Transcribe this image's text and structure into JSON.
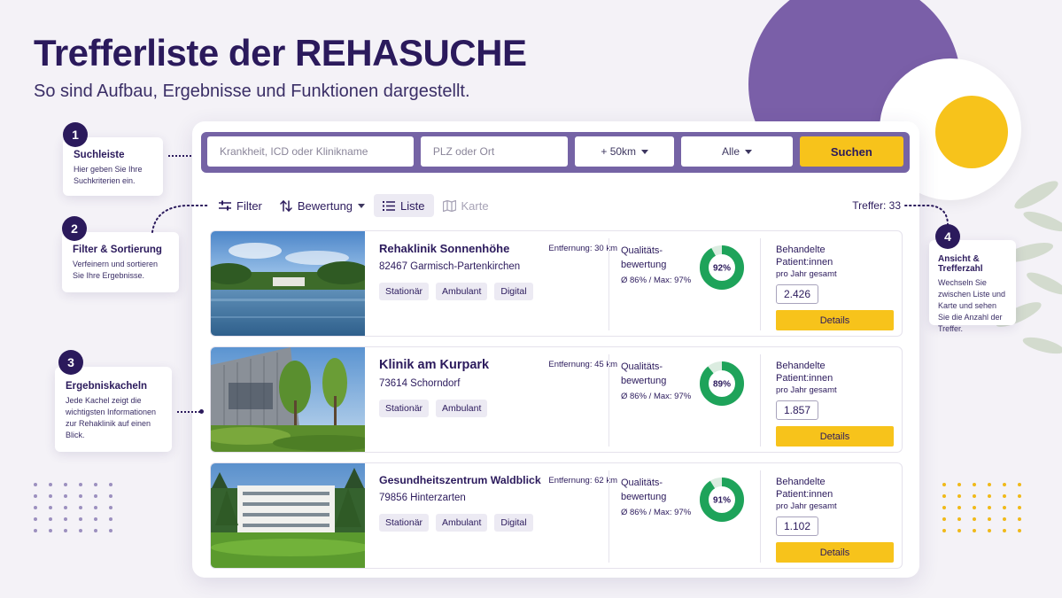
{
  "header": {
    "title": "Trefferliste der REHASUCHE",
    "subtitle": "So sind Aufbau, Ergebnisse und Funktionen dargestellt."
  },
  "search": {
    "query_placeholder": "Krankheit, ICD oder Klinikname",
    "location_placeholder": "PLZ oder Ort",
    "radius": "+ 50km",
    "type": "Alle",
    "submit_label": "Suchen"
  },
  "toolbar": {
    "filter_label": "Filter",
    "sort_label": "Bewertung",
    "list_label": "Liste",
    "map_label": "Karte",
    "result_count": "Treffer: 33"
  },
  "results": [
    {
      "name": "Rehaklinik Sonnenhöhe",
      "city": "82467 Garmisch-Partenkirchen",
      "distance": "Entfernung: 30 km",
      "tags": [
        "Stationär",
        "Ambulant",
        "Digital"
      ],
      "quality_label": "Qualitäts-bewertung",
      "quality_avg": "Ø 86% / Max: 97%",
      "quality_score": 92,
      "quality_score_label": "92%",
      "patients_label": "Behandelte Patient:innen",
      "patients_sub": "pro Jahr gesamt",
      "patients_value": "2.426",
      "details_label": "Details"
    },
    {
      "name": "Klinik am Kurpark",
      "city": "73614 Schorndorf",
      "distance": "Entfernung: 45 km",
      "tags": [
        "Stationär",
        "Ambulant"
      ],
      "quality_label": "Qualitäts-bewertung",
      "quality_avg": "Ø 86% / Max: 97%",
      "quality_score": 89,
      "quality_score_label": "89%",
      "patients_label": "Behandelte Patient:innen",
      "patients_sub": "pro Jahr gesamt",
      "patients_value": "1.857",
      "details_label": "Details"
    },
    {
      "name": "Gesundheitszentrum Waldblick",
      "city": "79856 Hinterzarten",
      "distance": "Entfernung: 62 km",
      "tags": [
        "Stationär",
        "Ambulant",
        "Digital"
      ],
      "quality_label": "Qualitäts-bewertung",
      "quality_avg": "Ø 86% / Max: 97%",
      "quality_score": 91,
      "quality_score_label": "91%",
      "patients_label": "Behandelte Patient:innen",
      "patients_sub": "pro Jahr gesamt",
      "patients_value": "1.102",
      "details_label": "Details"
    }
  ],
  "callouts": [
    {
      "number": "1",
      "title": "Suchleiste",
      "text": "Hier geben Sie Ihre Suchkriterien ein."
    },
    {
      "number": "2",
      "title": "Filter & Sortierung",
      "text": "Verfeinern und sortieren Sie Ihre Ergebnisse."
    },
    {
      "number": "3",
      "title": "Ergebniskacheln",
      "text": "Jede Kachel zeigt die wichtigsten Informationen zur Rehaklinik auf einen Blick."
    },
    {
      "number": "4",
      "title": "Ansicht & Trefferzahl",
      "text": "Wechseln Sie zwischen Liste und Karte und sehen Sie die Anzahl der Treffer."
    }
  ],
  "colors": {
    "brand": "#2b1a5c",
    "searchbar": "#7563a5",
    "accent": "#f7c31b",
    "score_ring": "#1ea35a"
  }
}
